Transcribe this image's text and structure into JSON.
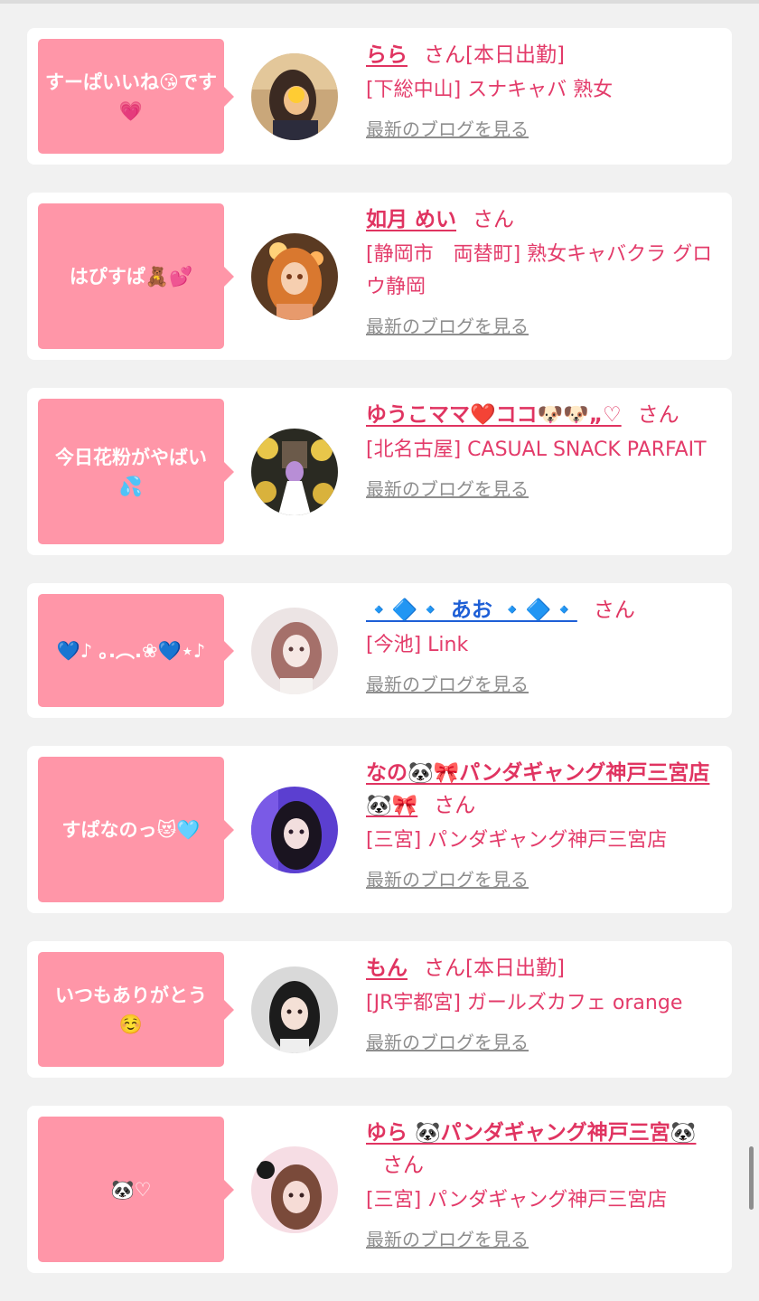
{
  "colors": {
    "accent": "#e03461",
    "bubble": "#ff96a8",
    "link_gray": "#8e8e8e"
  },
  "cards": [
    {
      "comment": "すーぱいいね😘です💗",
      "name": "らら",
      "san": "さん",
      "status": "[本日出勤]",
      "shop": "[下総中山] スナキャバ 熟女",
      "blog": "最新のブログを見る",
      "avatar": "avatar-woman-icon"
    },
    {
      "comment": "はぴすぱ🧸💕",
      "name": "如月 めい",
      "san": "さん",
      "status": "",
      "shop": "[静岡市　両替町] 熟女キャバクラ グロウ静岡",
      "blog": "最新のブログを見る",
      "avatar": "avatar-anime-girl-icon"
    },
    {
      "comment": "今日花粉がやばい💦",
      "name": "ゆうこママ❤️ココ🐶🐶„♡",
      "san": "さん",
      "status": "",
      "shop": "[北名古屋] CASUAL SNACK PARFAIT",
      "blog": "最新のブログを見る",
      "avatar": "avatar-flowers-icon"
    },
    {
      "comment": "💙♪ ｡.︵.❀💙⋆♪",
      "name": "🔹🔷🔹 あお 🔹🔷🔹",
      "san": "さん",
      "status": "",
      "shop": "[今池] Link",
      "blog": "最新のブログを見る",
      "avatar": "avatar-illustration-icon"
    },
    {
      "comment": "すぱなのっ😻🩵",
      "name": "なの🐼🎀パンダギャング神戸三宮店🐼🎀",
      "san": "さん",
      "status": "",
      "shop": "[三宮] パンダギャング神戸三宮店",
      "blog": "最新のブログを見る",
      "avatar": "avatar-purple-girl-icon"
    },
    {
      "comment": "いつもありがとう☺️",
      "name": "もん",
      "san": "さん",
      "status": "[本日出勤]",
      "shop": "[JR宇都宮] ガールズカフェ orange",
      "blog": "最新のブログを見る",
      "avatar": "avatar-girl-photo-icon"
    },
    {
      "comment": "🐼♡",
      "name": "ゆら 🐼パンダギャング神戸三宮🐼",
      "san": "さん",
      "status": "",
      "shop": "[三宮] パンダギャング神戸三宮店",
      "blog": "最新のブログを見る",
      "avatar": "avatar-pink-girl-icon"
    }
  ]
}
